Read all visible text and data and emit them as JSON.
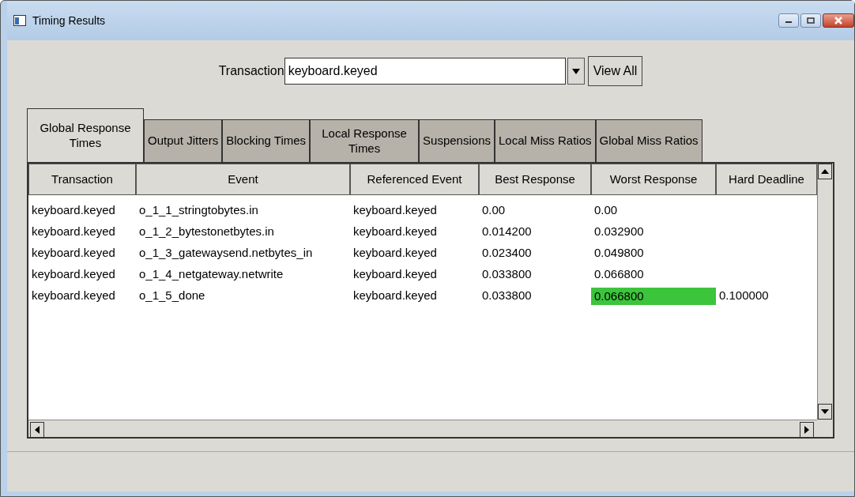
{
  "window": {
    "title": "Timing Results"
  },
  "transaction": {
    "label": "Transaction",
    "value": "keyboard.keyed",
    "view_all": "View All"
  },
  "tabs": [
    {
      "label": "Global Response Times",
      "selected": true
    },
    {
      "label": "Output Jitters",
      "selected": false
    },
    {
      "label": "Blocking Times",
      "selected": false
    },
    {
      "label": "Local Response Times",
      "selected": false
    },
    {
      "label": "Suspensions",
      "selected": false
    },
    {
      "label": "Local Miss Ratios",
      "selected": false
    },
    {
      "label": "Global Miss Ratios",
      "selected": false
    }
  ],
  "table": {
    "columns": [
      "Transaction",
      "Event",
      "Referenced Event",
      "Best Response",
      "Worst Response",
      "Hard Deadline"
    ],
    "rows": [
      {
        "cells": [
          {
            "text": "keyboard.keyed",
            "highlighted": false
          },
          {
            "text": "o_1_1_stringtobytes.in",
            "highlighted": false
          },
          {
            "text": "keyboard.keyed",
            "highlighted": false
          },
          {
            "text": "0.00",
            "highlighted": false
          },
          {
            "text": "0.00",
            "highlighted": false
          }
        ]
      },
      {
        "cells": [
          {
            "text": "keyboard.keyed",
            "highlighted": false
          },
          {
            "text": "o_1_2_bytestonetbytes.in",
            "highlighted": false
          },
          {
            "text": "keyboard.keyed",
            "highlighted": false
          },
          {
            "text": "0.014200",
            "highlighted": false
          },
          {
            "text": "0.032900",
            "highlighted": false
          }
        ]
      },
      {
        "cells": [
          {
            "text": "keyboard.keyed",
            "highlighted": false
          },
          {
            "text": "o_1_3_gatewaysend.netbytes_in",
            "highlighted": false
          },
          {
            "text": "keyboard.keyed",
            "highlighted": false
          },
          {
            "text": "0.023400",
            "highlighted": false
          },
          {
            "text": "0.049800",
            "highlighted": false
          }
        ]
      },
      {
        "cells": [
          {
            "text": "keyboard.keyed",
            "highlighted": false
          },
          {
            "text": "o_1_4_netgateway.netwrite",
            "highlighted": false
          },
          {
            "text": "keyboard.keyed",
            "highlighted": false
          },
          {
            "text": "0.033800",
            "highlighted": false
          },
          {
            "text": "0.066800",
            "highlighted": false
          }
        ]
      },
      {
        "cells": [
          {
            "text": "keyboard.keyed",
            "highlighted": false
          },
          {
            "text": "o_1_5_done",
            "highlighted": false
          },
          {
            "text": "keyboard.keyed",
            "highlighted": false
          },
          {
            "text": "0.033800",
            "highlighted": false
          },
          {
            "text": "0.066800",
            "highlighted": true
          },
          {
            "text": "0.100000",
            "highlighted": false
          }
        ]
      }
    ]
  }
}
